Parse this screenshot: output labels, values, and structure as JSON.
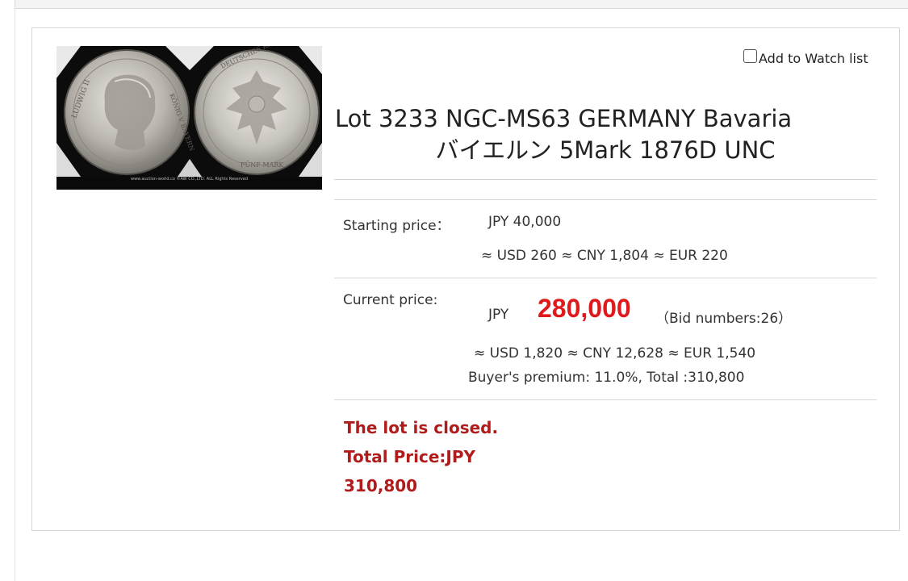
{
  "lot": {
    "title_line1": "Lot 3233 NGC-MS63  GERMANY Bavaria",
    "title_line2": "バイエルン 5Mark 1876D UNC",
    "image_footer": "www.auction-world.co  ©AW CO.,LTD. ALL Rights Reserved",
    "watch_label": "Add to Watch list"
  },
  "starting": {
    "label": "Starting price：",
    "value": "JPY 40,000",
    "converted": "≈ USD 260 ≈ CNY 1,804 ≈ EUR 220"
  },
  "current": {
    "label": "Current price:",
    "currency": "JPY",
    "value": "280,000",
    "bids": "（Bid numbers:26）",
    "converted": "≈ USD 1,820 ≈ CNY 12,628 ≈ EUR 1,540",
    "premium": "Buyer's premium: 11.0%, Total :310,800"
  },
  "status": {
    "line1": "The lot is closed.",
    "line2": "Total Price:JPY",
    "line3": "310,800"
  },
  "colors": {
    "price_red": "#e0191c",
    "closed_red": "#b01c1c"
  },
  "icons": [
    "checkbox-icon"
  ]
}
